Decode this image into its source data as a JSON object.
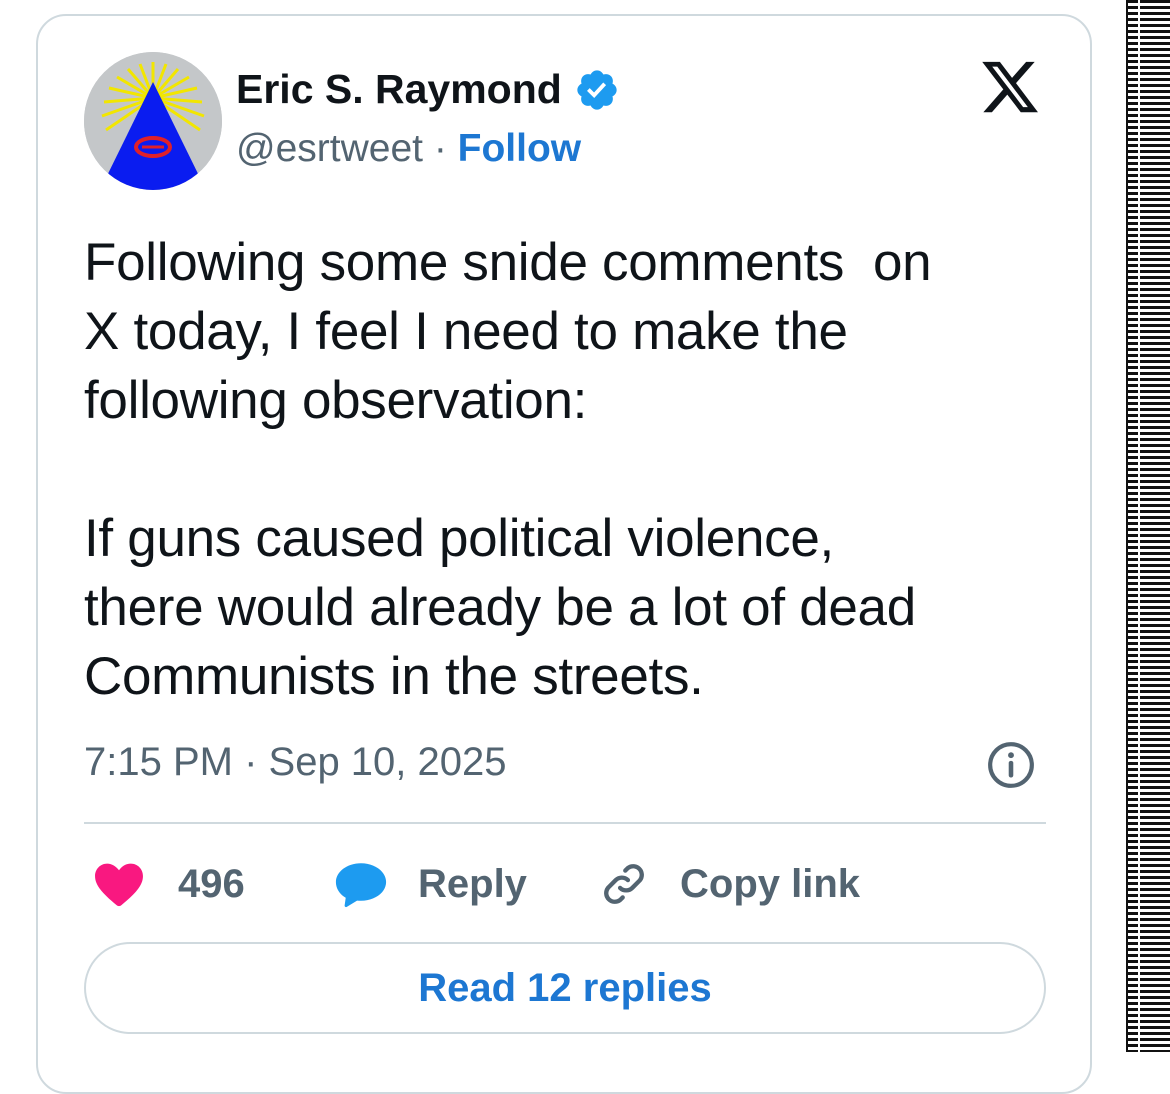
{
  "author": {
    "display_name": "Eric S. Raymond",
    "handle": "@esrtweet",
    "separator": " · ",
    "follow_label": "Follow",
    "verified": true
  },
  "tweet": {
    "text": "Following some snide comments  on\nX today, I feel I need to make the\nfollowing observation:\n\nIf guns caused political violence,\nthere would already be a lot of dead\nCommunists in the streets.",
    "timestamp": "7:15 PM · Sep 10, 2025"
  },
  "actions": {
    "like_count": "496",
    "reply_label": "Reply",
    "copy_link_label": "Copy link"
  },
  "read_replies_label": "Read 12 replies",
  "colors": {
    "link_blue": "#1d77d2",
    "like_pink": "#f91880",
    "reply_blue": "#1d9bf0",
    "muted_text": "#536471",
    "border": "#cfd9de"
  },
  "icons": {
    "platform": "x-logo-icon",
    "verified": "verified-badge-icon",
    "info": "info-icon",
    "like": "heart-icon",
    "reply": "speech-bubble-icon",
    "copy": "link-icon"
  }
}
